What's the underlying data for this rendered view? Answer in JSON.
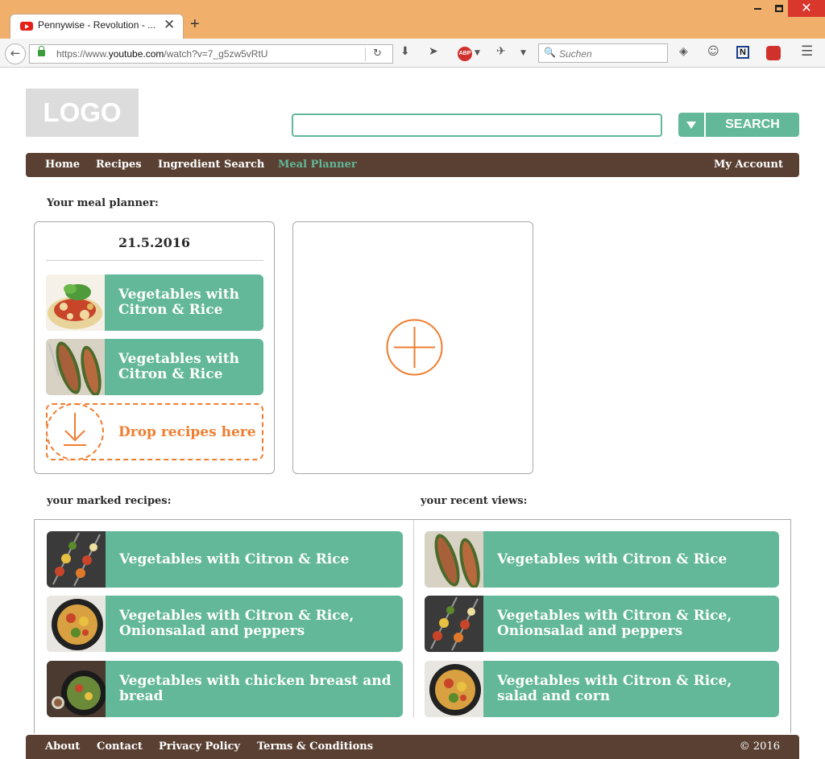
{
  "browser": {
    "tab_title": "Pennywise - Revolution - ...",
    "url_prefix": "https://www.",
    "url_domain": "youtube.com",
    "url_path": "/watch?v=7_g5zw5vRtU",
    "search_placeholder": "Suchen",
    "close_symbol": "✕",
    "new_tab_symbol": "+"
  },
  "header": {
    "logo_text": "LOGO",
    "search_button": "SEARCH"
  },
  "menu": {
    "items": [
      "Home",
      "Recipes",
      "Ingredient Search",
      "Meal Planner"
    ],
    "active": "Meal Planner",
    "account": "My Account"
  },
  "planner": {
    "heading": "Your meal planner:",
    "date": "21.5.2016",
    "recipes": [
      {
        "title": "Vegetables with Citron & Rice",
        "image": "pasta-icon"
      },
      {
        "title": "Vegetables with Citron & Rice",
        "image": "stuffed-zucchini-icon"
      }
    ],
    "drop_label": "Drop recipes here"
  },
  "marked": {
    "heading": "your marked recipes:",
    "recipes": [
      {
        "title": "Vegetables with Citron & Rice",
        "image": "skewer-icon"
      },
      {
        "title": "Vegetables with Citron & Rice, Onionsalad and peppers",
        "image": "pan-icon"
      },
      {
        "title": "Vegetables with chicken breast and bread",
        "image": "wok-icon"
      }
    ]
  },
  "recent": {
    "heading": "your recent views:",
    "recipes": [
      {
        "title": "Vegetables with Citron & Rice",
        "image": "stuffed-zucchini-icon"
      },
      {
        "title": "Vegetables with Citron & Rice, Onionsalad and peppers",
        "image": "skewer-icon"
      },
      {
        "title": "Vegetables with Citron & Rice, salad and corn",
        "image": "pan-icon"
      }
    ]
  },
  "footer": {
    "links": [
      "About",
      "Contact",
      "Privacy Policy",
      "Terms & Conditions"
    ],
    "copyright": "© 2016"
  },
  "colors": {
    "accent_green": "#62b899",
    "accent_orange": "#f07d2f",
    "nav_brown": "#5a4032",
    "titlebar_orange": "#f0b06b"
  }
}
